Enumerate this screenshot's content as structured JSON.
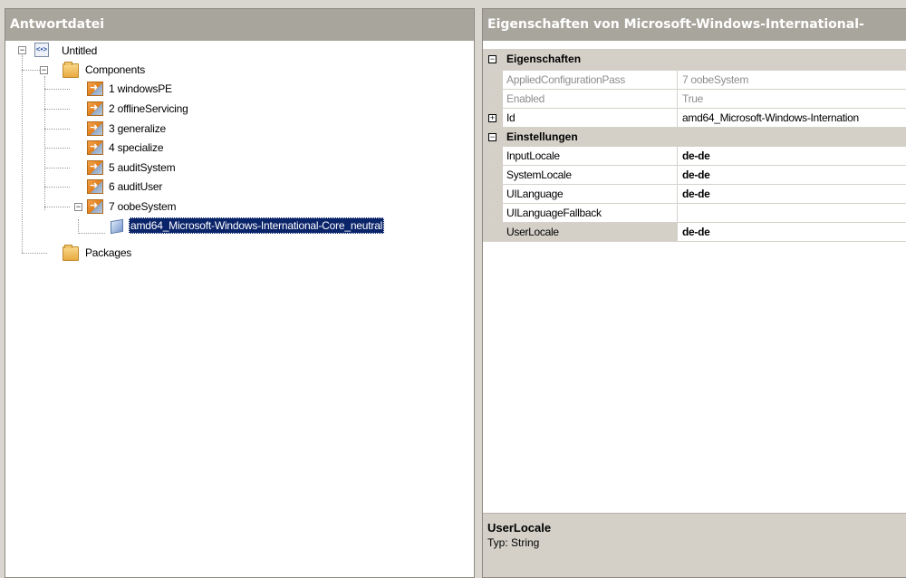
{
  "left_pane": {
    "title": "Antwortdatei",
    "tree": {
      "root_label": "Untitled",
      "components_label": "Components",
      "passes": [
        {
          "label": "1 windowsPE"
        },
        {
          "label": "2 offlineServicing"
        },
        {
          "label": "3 generalize"
        },
        {
          "label": "4 specialize"
        },
        {
          "label": "5 auditSystem"
        },
        {
          "label": "6 auditUser"
        },
        {
          "label": "7 oobeSystem"
        }
      ],
      "selected_component": "amd64_Microsoft-Windows-International-Core_neutral",
      "packages_label": "Packages"
    }
  },
  "right_pane": {
    "title": "Eigenschaften von Microsoft-Windows-International-",
    "categories": {
      "properties_label": "Eigenschaften",
      "settings_label": "Einstellungen"
    },
    "properties": [
      {
        "name": "AppliedConfigurationPass",
        "value": "7 oobeSystem"
      },
      {
        "name": "Enabled",
        "value": "True"
      },
      {
        "name": "Id",
        "value": "amd64_Microsoft-Windows-Internation"
      }
    ],
    "settings": [
      {
        "name": "InputLocale",
        "value": "de-de"
      },
      {
        "name": "SystemLocale",
        "value": "de-de"
      },
      {
        "name": "UILanguage",
        "value": "de-de"
      },
      {
        "name": "UILanguageFallback",
        "value": ""
      },
      {
        "name": "UserLocale",
        "value": "de-de"
      }
    ],
    "description": {
      "title": "UserLocale",
      "text": "Typ: String"
    }
  }
}
